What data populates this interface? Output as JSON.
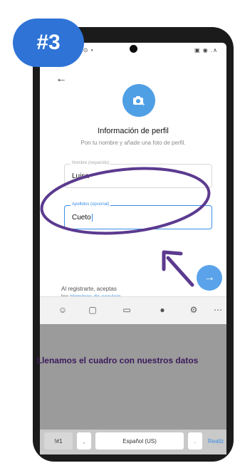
{
  "badge": "#3",
  "status": {
    "left": "5:09 ⊙ •",
    "right": "▣ ◉ .∧"
  },
  "profile": {
    "title": "Información de perfil",
    "subtitle": "Pon tu nombre y añade una foto de perfil.",
    "first_name": {
      "label": "Nombre (requerido)",
      "value": "Luisa"
    },
    "last_name": {
      "label": "Apellidos (opcional)",
      "value": "Cueto"
    },
    "terms_prefix": "Al registrarte, aceptas",
    "terms_mid": "los",
    "terms_link": "términos de servicio",
    "terms_suffix": ".",
    "next_arrow": "→"
  },
  "caption": "Llenamos el cuadro con nuestros datos",
  "keyboard": {
    "symbols": "!#1",
    "comma": ",",
    "space": "Español (US)",
    "period": ".",
    "action": "Realiz"
  },
  "colors": {
    "accent": "#3a8ee6",
    "badge": "#2f73d6",
    "annotation": "#5b3a8f",
    "caption": "#3b1a5c"
  }
}
